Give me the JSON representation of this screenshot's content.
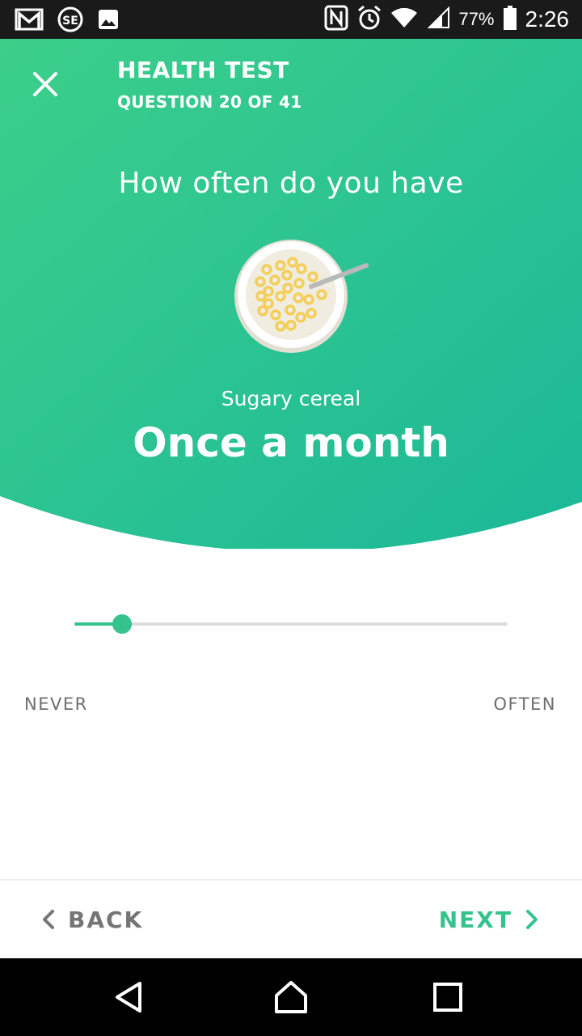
{
  "status_bar": {
    "battery_percent": "77%",
    "time": "2:26",
    "left_icons": [
      "gmail-icon",
      "stocard-icon",
      "gallery-icon"
    ],
    "right_icons": [
      "nfc-icon",
      "alarm-icon",
      "wifi-icon",
      "signal-icon",
      "battery-icon"
    ]
  },
  "header": {
    "title": "HEALTH TEST",
    "subtitle": "QUESTION 20 OF 41",
    "close_icon": "close-icon"
  },
  "question": {
    "prompt": "How often do you have",
    "food_name": "Sugary cereal",
    "answer": "Once a month",
    "illustration": "cereal-bowl-icon"
  },
  "slider": {
    "value": 0.11,
    "min_label": "NEVER",
    "max_label": "OFTEN"
  },
  "navigation": {
    "back_label": "BACK",
    "next_label": "NEXT"
  },
  "colors": {
    "accent": "#35c38d",
    "gradient_start": "#3ccf8a",
    "gradient_end": "#1bb899",
    "muted_text": "#757575"
  }
}
